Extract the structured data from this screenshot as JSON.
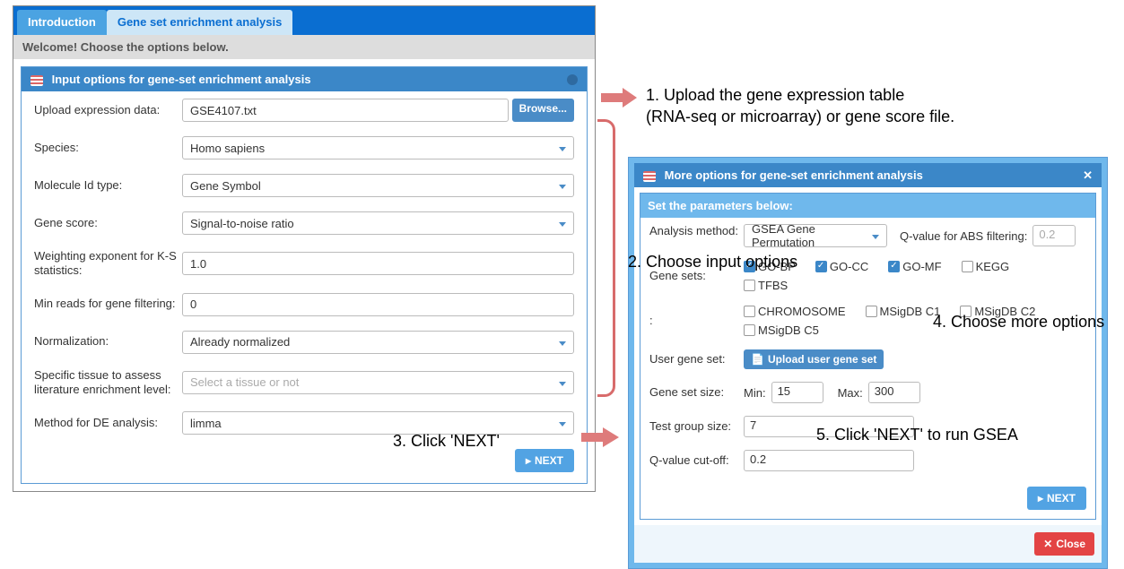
{
  "left": {
    "tabs": [
      "Introduction",
      "Gene set enrichment analysis"
    ],
    "welcome": "Welcome! Choose the options below.",
    "panelTitle": "Input options for gene-set enrichment analysis",
    "rows": {
      "upload": {
        "label": "Upload expression data:",
        "value": "GSE4107.txt",
        "browse": "Browse..."
      },
      "species": {
        "label": "Species:",
        "value": "Homo sapiens"
      },
      "molid": {
        "label": "Molecule Id type:",
        "value": "Gene Symbol"
      },
      "score": {
        "label": "Gene score:",
        "value": "Signal-to-noise ratio"
      },
      "weight": {
        "label": "Weighting exponent for K-S statistics:",
        "value": "1.0"
      },
      "minreads": {
        "label": "Min reads for gene filtering:",
        "value": "0"
      },
      "norm": {
        "label": "Normalization:",
        "value": "Already normalized"
      },
      "tissue": {
        "label": "Specific tissue to assess literature enrichment level:",
        "placeholder": "Select a tissue or not"
      },
      "deMethod": {
        "label": "Method for DE analysis:",
        "value": "limma"
      }
    },
    "next": "NEXT"
  },
  "right": {
    "headerTitle": "More options for gene-set enrichment analysis",
    "innerTitle": "Set the parameters below:",
    "analysis": {
      "label": "Analysis method:",
      "value": "GSEA Gene Permutation"
    },
    "qfilter": {
      "label": "Q-value for ABS filtering:",
      "value": "0.2"
    },
    "genesetsLabel": "Gene sets:",
    "genesets": [
      {
        "name": "GO-BP",
        "checked": true
      },
      {
        "name": "GO-CC",
        "checked": true
      },
      {
        "name": "GO-MF",
        "checked": true
      },
      {
        "name": "KEGG",
        "checked": false
      },
      {
        "name": "TFBS",
        "checked": false
      }
    ],
    "genesets2": [
      {
        "name": "CHROMOSOME",
        "checked": false
      },
      {
        "name": "MSigDB C1",
        "checked": false
      },
      {
        "name": "MSigDB C2",
        "checked": false
      },
      {
        "name": "MSigDB C5",
        "checked": false
      }
    ],
    "userGeneSet": {
      "label": "User gene set:",
      "button": "Upload user gene set"
    },
    "sizeRow": {
      "label": "Gene set size:",
      "minLabel": "Min:",
      "min": "15",
      "maxLabel": "Max:",
      "max": "300"
    },
    "testGroup": {
      "label": "Test group size:",
      "value": "7"
    },
    "qcut": {
      "label": "Q-value cut-off:",
      "value": "0.2"
    },
    "next": "NEXT",
    "close": "Close"
  },
  "anno": {
    "a1": "1. Upload the gene expression table\n(RNA-seq or microarray) or gene score file.",
    "a2": "2. Choose input options",
    "a3": "3. Click 'NEXT'",
    "a4": "4. Choose more options",
    "a5": "5. Click 'NEXT' to run GSEA"
  }
}
